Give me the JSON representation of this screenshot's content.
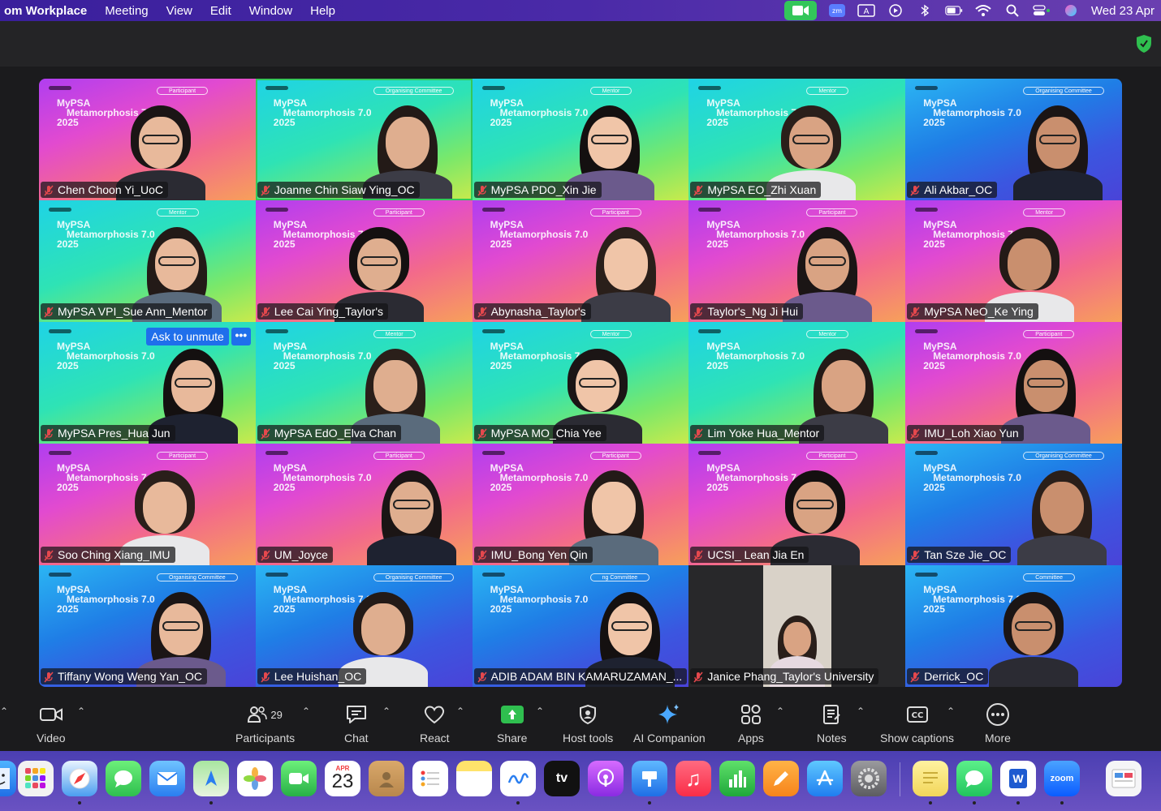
{
  "menubar": {
    "app_name": "om Workplace",
    "menus": [
      "Meeting",
      "View",
      "Edit",
      "Window",
      "Help"
    ],
    "status_icons": [
      "zoom-video-icon",
      "zoom-icon",
      "input-source-icon",
      "play-icon",
      "bluetooth-icon",
      "battery-icon",
      "wifi-icon",
      "search-icon",
      "control-center-icon",
      "siri-icon"
    ],
    "clock": "Wed 23 Apr"
  },
  "tiles": [
    {
      "name": "Chen Choon Yi_UoC",
      "theme": "pink",
      "role": "Participant"
    },
    {
      "name": "Joanne Chin Siaw Ying_OC",
      "theme": "green",
      "role": "Organising Committee",
      "active": true
    },
    {
      "name": "MyPSA PDO_Xin Jie",
      "theme": "green",
      "role": "Mentor"
    },
    {
      "name": "MyPSA EO_Zhi Xuan",
      "theme": "green",
      "role": "Mentor"
    },
    {
      "name": "Ali Akbar_OC",
      "theme": "blue",
      "role": "Organising Committee"
    },
    {
      "name": "MyPSA VPI_Sue Ann_Mentor",
      "theme": "green",
      "role": "Mentor"
    },
    {
      "name": "Lee Cai Ying_Taylor's",
      "theme": "pink",
      "role": "Participant"
    },
    {
      "name": "Abynasha_Taylor's",
      "theme": "pink",
      "role": "Participant"
    },
    {
      "name": "Taylor's_Ng Ji Hui",
      "theme": "pink",
      "role": "Participant"
    },
    {
      "name": "MyPSA NeO_Ke Ying",
      "theme": "pink",
      "role": "Mentor"
    },
    {
      "name": "MyPSA Pres_Hua Jun",
      "theme": "green",
      "role": "Mentor",
      "unmute": true
    },
    {
      "name": "MyPSA EdO_Elva Chan",
      "theme": "green",
      "role": "Mentor"
    },
    {
      "name": "MyPSA MO_Chia Yee",
      "theme": "green",
      "role": "Mentor"
    },
    {
      "name": "Lim Yoke Hua_Mentor",
      "theme": "green",
      "role": "Mentor"
    },
    {
      "name": "IMU_Loh Xiao Yun",
      "theme": "pink",
      "role": "Participant"
    },
    {
      "name": "Soo Ching Xiang_IMU",
      "theme": "pink",
      "role": "Participant"
    },
    {
      "name": "UM_Joyce",
      "theme": "pink",
      "role": "Participant"
    },
    {
      "name": "IMU_Bong Yen Qin",
      "theme": "pink",
      "role": "Participant"
    },
    {
      "name": "UCSI_ Lean Jia En",
      "theme": "pink",
      "role": "Participant"
    },
    {
      "name": "Tan Sze Jie_OC",
      "theme": "blue",
      "role": "Organising Committee"
    },
    {
      "name": "Tiffany Wong Weng Yan_OC",
      "theme": "blue",
      "role": "Organising Committee"
    },
    {
      "name": "Lee Huishan_OC",
      "theme": "blue",
      "role": "Organising Committee"
    },
    {
      "name": "ADIB ADAM BIN KAMARUZAMAN_...",
      "theme": "blue",
      "role": "ng Committee"
    },
    {
      "name": "Janice Phang_Taylor's University",
      "theme": "dark",
      "role": ""
    },
    {
      "name": "Derrick_OC",
      "theme": "blue",
      "role": "Committee"
    }
  ],
  "banner": {
    "line1": "MyPSA",
    "line2": "Metamorphosis 7.0",
    "line3": "2025"
  },
  "unmute": {
    "label": "Ask to unmute",
    "more": "•••"
  },
  "toolbar": {
    "video": "Video",
    "participants": "Participants",
    "participants_count": "29",
    "chat": "Chat",
    "react": "React",
    "share": "Share",
    "host_tools": "Host tools",
    "ai_companion": "AI Companion",
    "apps": "Apps",
    "notes": "Notes",
    "captions": "Show captions",
    "more": "More"
  },
  "dock": {
    "calendar_month": "APR",
    "calendar_day": "23",
    "tv_label": "tv",
    "zoom_label": "zoom",
    "apps": [
      "finder",
      "launchpad",
      "safari",
      "messages",
      "mail",
      "maps",
      "photos",
      "facetime",
      "calendar",
      "contacts",
      "reminders",
      "notes",
      "freeform",
      "tv",
      "podcasts",
      "keynote",
      "music",
      "numbers",
      "pages",
      "app-store",
      "system-settings",
      "stickies",
      "whatsapp",
      "word",
      "zoom",
      "preview"
    ]
  },
  "colors": {
    "accent_blue": "#1f6feb",
    "share_green": "#2fbf4f",
    "active_border": "#34c759",
    "mic_red": "#e5484d"
  }
}
